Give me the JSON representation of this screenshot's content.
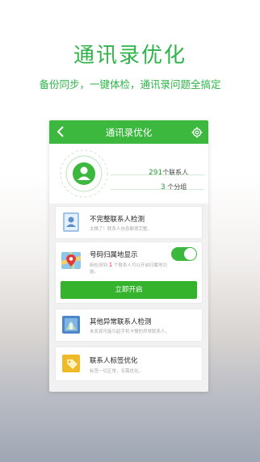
{
  "hero": {
    "title": "通讯录优化",
    "subtitle": "备份同步，一键体检，通讯录问题全搞定"
  },
  "topbar": {
    "title": "通讯录优化",
    "back_icon": "chevron-left-icon",
    "settings_icon": "gear-icon"
  },
  "summary": {
    "contacts_count": "291",
    "contacts_label": "个联系人",
    "groups_count": "3",
    "groups_label": "个分组"
  },
  "cards": [
    {
      "title": "不完整联系人检测",
      "desc": "太棒了！联系人信息都很完整。",
      "icon": "contact-card-icon"
    },
    {
      "title": "号码归属地显示",
      "desc_prefix": "新检测到",
      "desc_count": "1",
      "desc_suffix": "个联系人可以开启归属地功能。",
      "icon": "map-pin-icon",
      "toggle_on": true,
      "button_label": "立即开启"
    },
    {
      "title": "其他异常联系人检测",
      "desc": "未发现可能引起手机卡慢的异常联系人。",
      "icon": "contact-book-icon"
    },
    {
      "title": "联系人标签优化",
      "desc": "标签一切正常，无需优化。",
      "icon": "tag-icon"
    }
  ],
  "colors": {
    "brand_green": "#3cb83e",
    "hero_green": "#2fb44a",
    "alert_red": "#e03a3a"
  }
}
